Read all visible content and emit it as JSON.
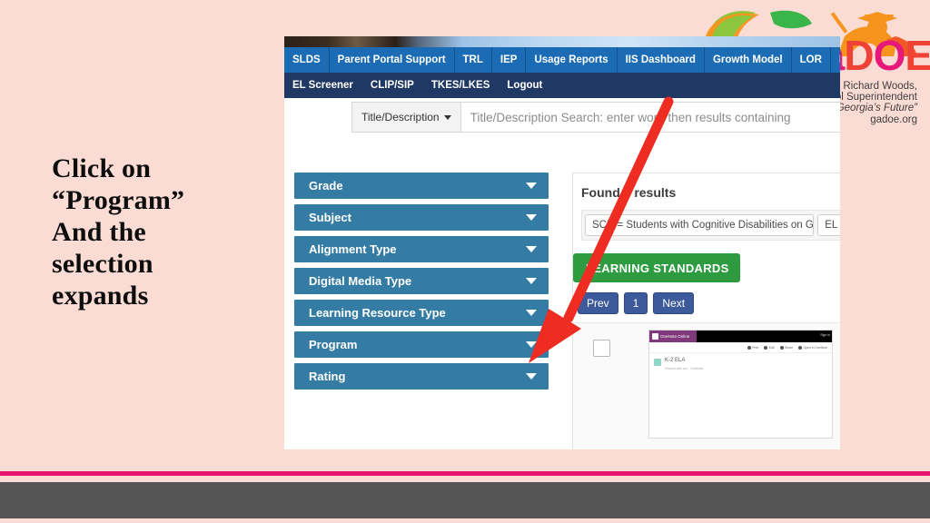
{
  "slide": {
    "instruction_lines": [
      "Click on",
      "“Program”",
      "And the",
      "selection",
      "expands"
    ],
    "background_color": "#fbdcd4"
  },
  "logo": {
    "wordmark_g": "Ga",
    "wordmark_d": "D",
    "wordmark_o": "O",
    "wordmark_e": "E",
    "line1": "Richard Woods,",
    "line2": "Georgia's School Superintendent",
    "line3": "“Educating Georgia’s Future”",
    "line4": "gadoe.org",
    "brand_pink": "#e6197a",
    "brand_orange": "#ef4136"
  },
  "nav": {
    "row1": [
      {
        "label": "SLDS"
      },
      {
        "label": "Parent Portal Support"
      },
      {
        "label": "TRL"
      },
      {
        "label": "IEP"
      },
      {
        "label": "Usage Reports"
      },
      {
        "label": "IIS Dashboard"
      },
      {
        "label": "Growth Model"
      },
      {
        "label": "LOR"
      },
      {
        "label": "L A"
      }
    ],
    "row2": [
      {
        "label": "EL Screener"
      },
      {
        "label": "CLIP/SIP"
      },
      {
        "label": "TKES/LKES"
      },
      {
        "label": "Logout"
      }
    ],
    "row1_color": "#1b6cb5",
    "row2_color": "#1f3864"
  },
  "search": {
    "select_label": "Title/Description",
    "placeholder": "Title/Description Search:  enter word then results containing"
  },
  "sidebar": {
    "items": [
      {
        "label": "Grade"
      },
      {
        "label": "Subject"
      },
      {
        "label": "Alignment Type"
      },
      {
        "label": "Digital Media Type"
      },
      {
        "label": "Learning Resource Type"
      },
      {
        "label": "Program"
      },
      {
        "label": "Rating"
      }
    ],
    "color": "#357ca5"
  },
  "results": {
    "found_text": "Found  0 results",
    "tags": [
      {
        "label": "SCD = Students with Cognitive Disabilities on GAA",
        "close": "X"
      },
      {
        "label": "EL",
        "close": "X"
      }
    ],
    "learning_standards_label": "LEARNING STANDARDS",
    "learning_standards_color": "#2e9b41",
    "pager": [
      {
        "label": "Prev"
      },
      {
        "label": "1"
      },
      {
        "label": "Next"
      }
    ],
    "card": {
      "thumb_brand": "OneNote Online",
      "thumb_signin": "Sign in",
      "thumb_title": "K-2 ELA",
      "thumb_subtitle": "Shared with me · OneNote",
      "ribbon": [
        {
          "label": "Print"
        },
        {
          "label": "Edit"
        },
        {
          "label": "Share"
        },
        {
          "label": "Open in OneNote"
        }
      ]
    }
  },
  "footer": {
    "pink_bar_color": "#e8146b",
    "gray_bar_color": "#555555"
  },
  "annotation": {
    "arrow_color": "#ef2c21",
    "arrow_points_to": "Program"
  }
}
